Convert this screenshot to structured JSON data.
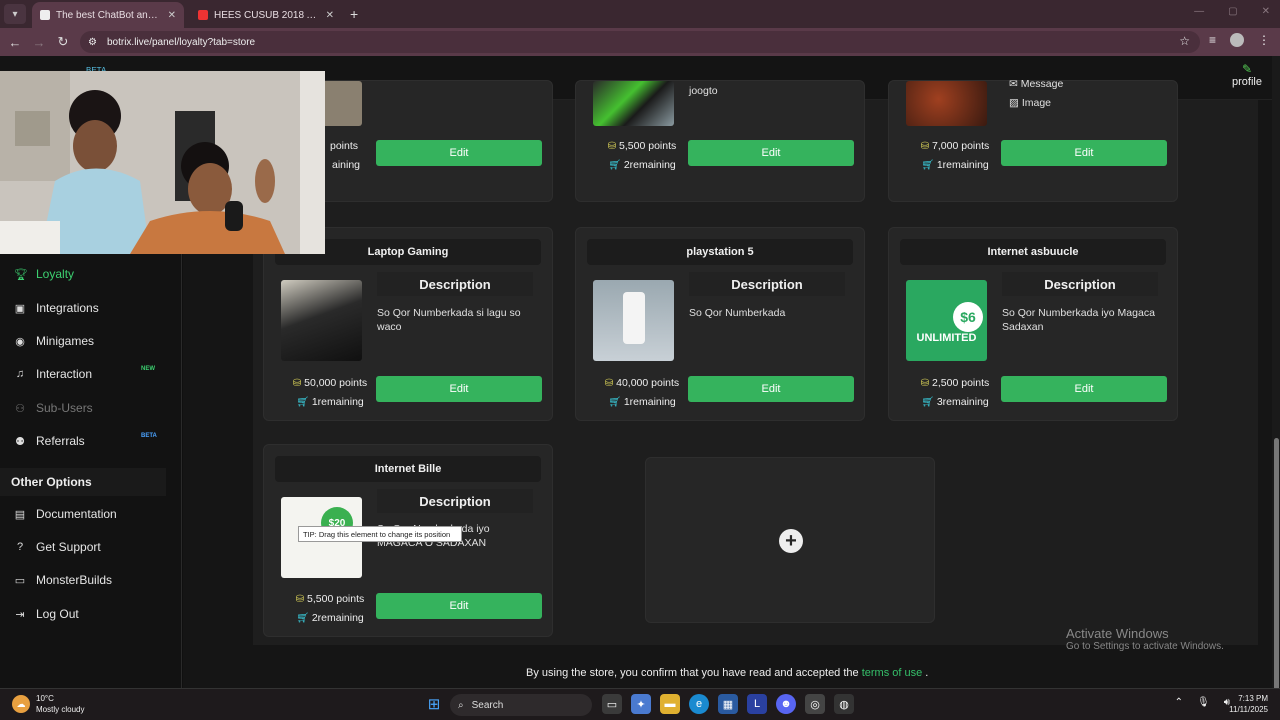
{
  "browser": {
    "tabs": [
      {
        "title": "The best ChatBot and Widgets",
        "active": true
      },
      {
        "title": "HEES CUSUB 2018 AFAR AABAH",
        "active": false
      }
    ],
    "url": "botrix.live/panel/loyalty?tab=store"
  },
  "header": {
    "beta": "BETA",
    "profile_label": "profile"
  },
  "sidebar": {
    "items": [
      {
        "label": "Loyalty",
        "icon": "trophy-icon"
      },
      {
        "label": "Integrations",
        "icon": "puzzle-icon"
      },
      {
        "label": "Minigames",
        "icon": "gamepad-icon"
      },
      {
        "label": "Interaction",
        "icon": "music-icon",
        "badge": "NEW"
      },
      {
        "label": "Sub-Users",
        "icon": "users-icon"
      },
      {
        "label": "Referrals",
        "icon": "referral-icon",
        "badge": "BETA"
      }
    ],
    "other_title": "Other Options",
    "other_items": [
      {
        "label": "Documentation",
        "icon": "book-icon"
      },
      {
        "label": "Get Support",
        "icon": "question-icon"
      },
      {
        "label": "MonsterBuilds",
        "icon": "monitor-icon"
      },
      {
        "label": "Log Out",
        "icon": "logout-icon"
      }
    ]
  },
  "store": {
    "description_heading": "Description",
    "edit_label": "Edit",
    "top_row": [
      {
        "points": "5,500 points",
        "remaining": "2remaining",
        "desc": "joogto"
      },
      {
        "points": "7,000 points",
        "remaining": "1remaining",
        "options": [
          "Message",
          "Image"
        ]
      },
      {
        "points": "points",
        "remaining": "aining"
      }
    ],
    "items": [
      {
        "title": "Laptop Gaming",
        "desc": "So Qor Numberkada si lagu so waco",
        "points": "50,000 points",
        "remaining": "1remaining"
      },
      {
        "title": "playstation 5",
        "desc": "So Qor Numberkada",
        "points": "40,000 points",
        "remaining": "1remaining"
      },
      {
        "title": "Internet asbuucle",
        "desc": "So Qor Numberkada iyo Magaca Sadaxan",
        "points": "2,500 points",
        "remaining": "3remaining"
      },
      {
        "title": "Internet Bille",
        "desc": "So Qor Numberkada iyo MAGACA O SADAXAN",
        "points": "5,500 points",
        "remaining": "2remaining"
      }
    ],
    "thumb_texts": {
      "price6": "$6",
      "unlimited": "UNLIMITED",
      "price20": "$20"
    },
    "tooltip": "TIP: Drag this element to change its position",
    "footer_text": "By using the store, you confirm that you have read and accepted the ",
    "footer_link": "terms of use",
    "footer_end": " ."
  },
  "watermark": {
    "line1": "Activate Windows",
    "line2": "Go to Settings to activate Windows."
  },
  "taskbar": {
    "temp": "10°C",
    "weather": "Mostly cloudy",
    "search": "Search",
    "time": "7:13 PM",
    "date": "11/11/2025"
  },
  "colors": {
    "accent": "#35b35d",
    "active_nav": "#3cd070",
    "coin": "#e0d85a",
    "cart": "#3ad0e0"
  }
}
